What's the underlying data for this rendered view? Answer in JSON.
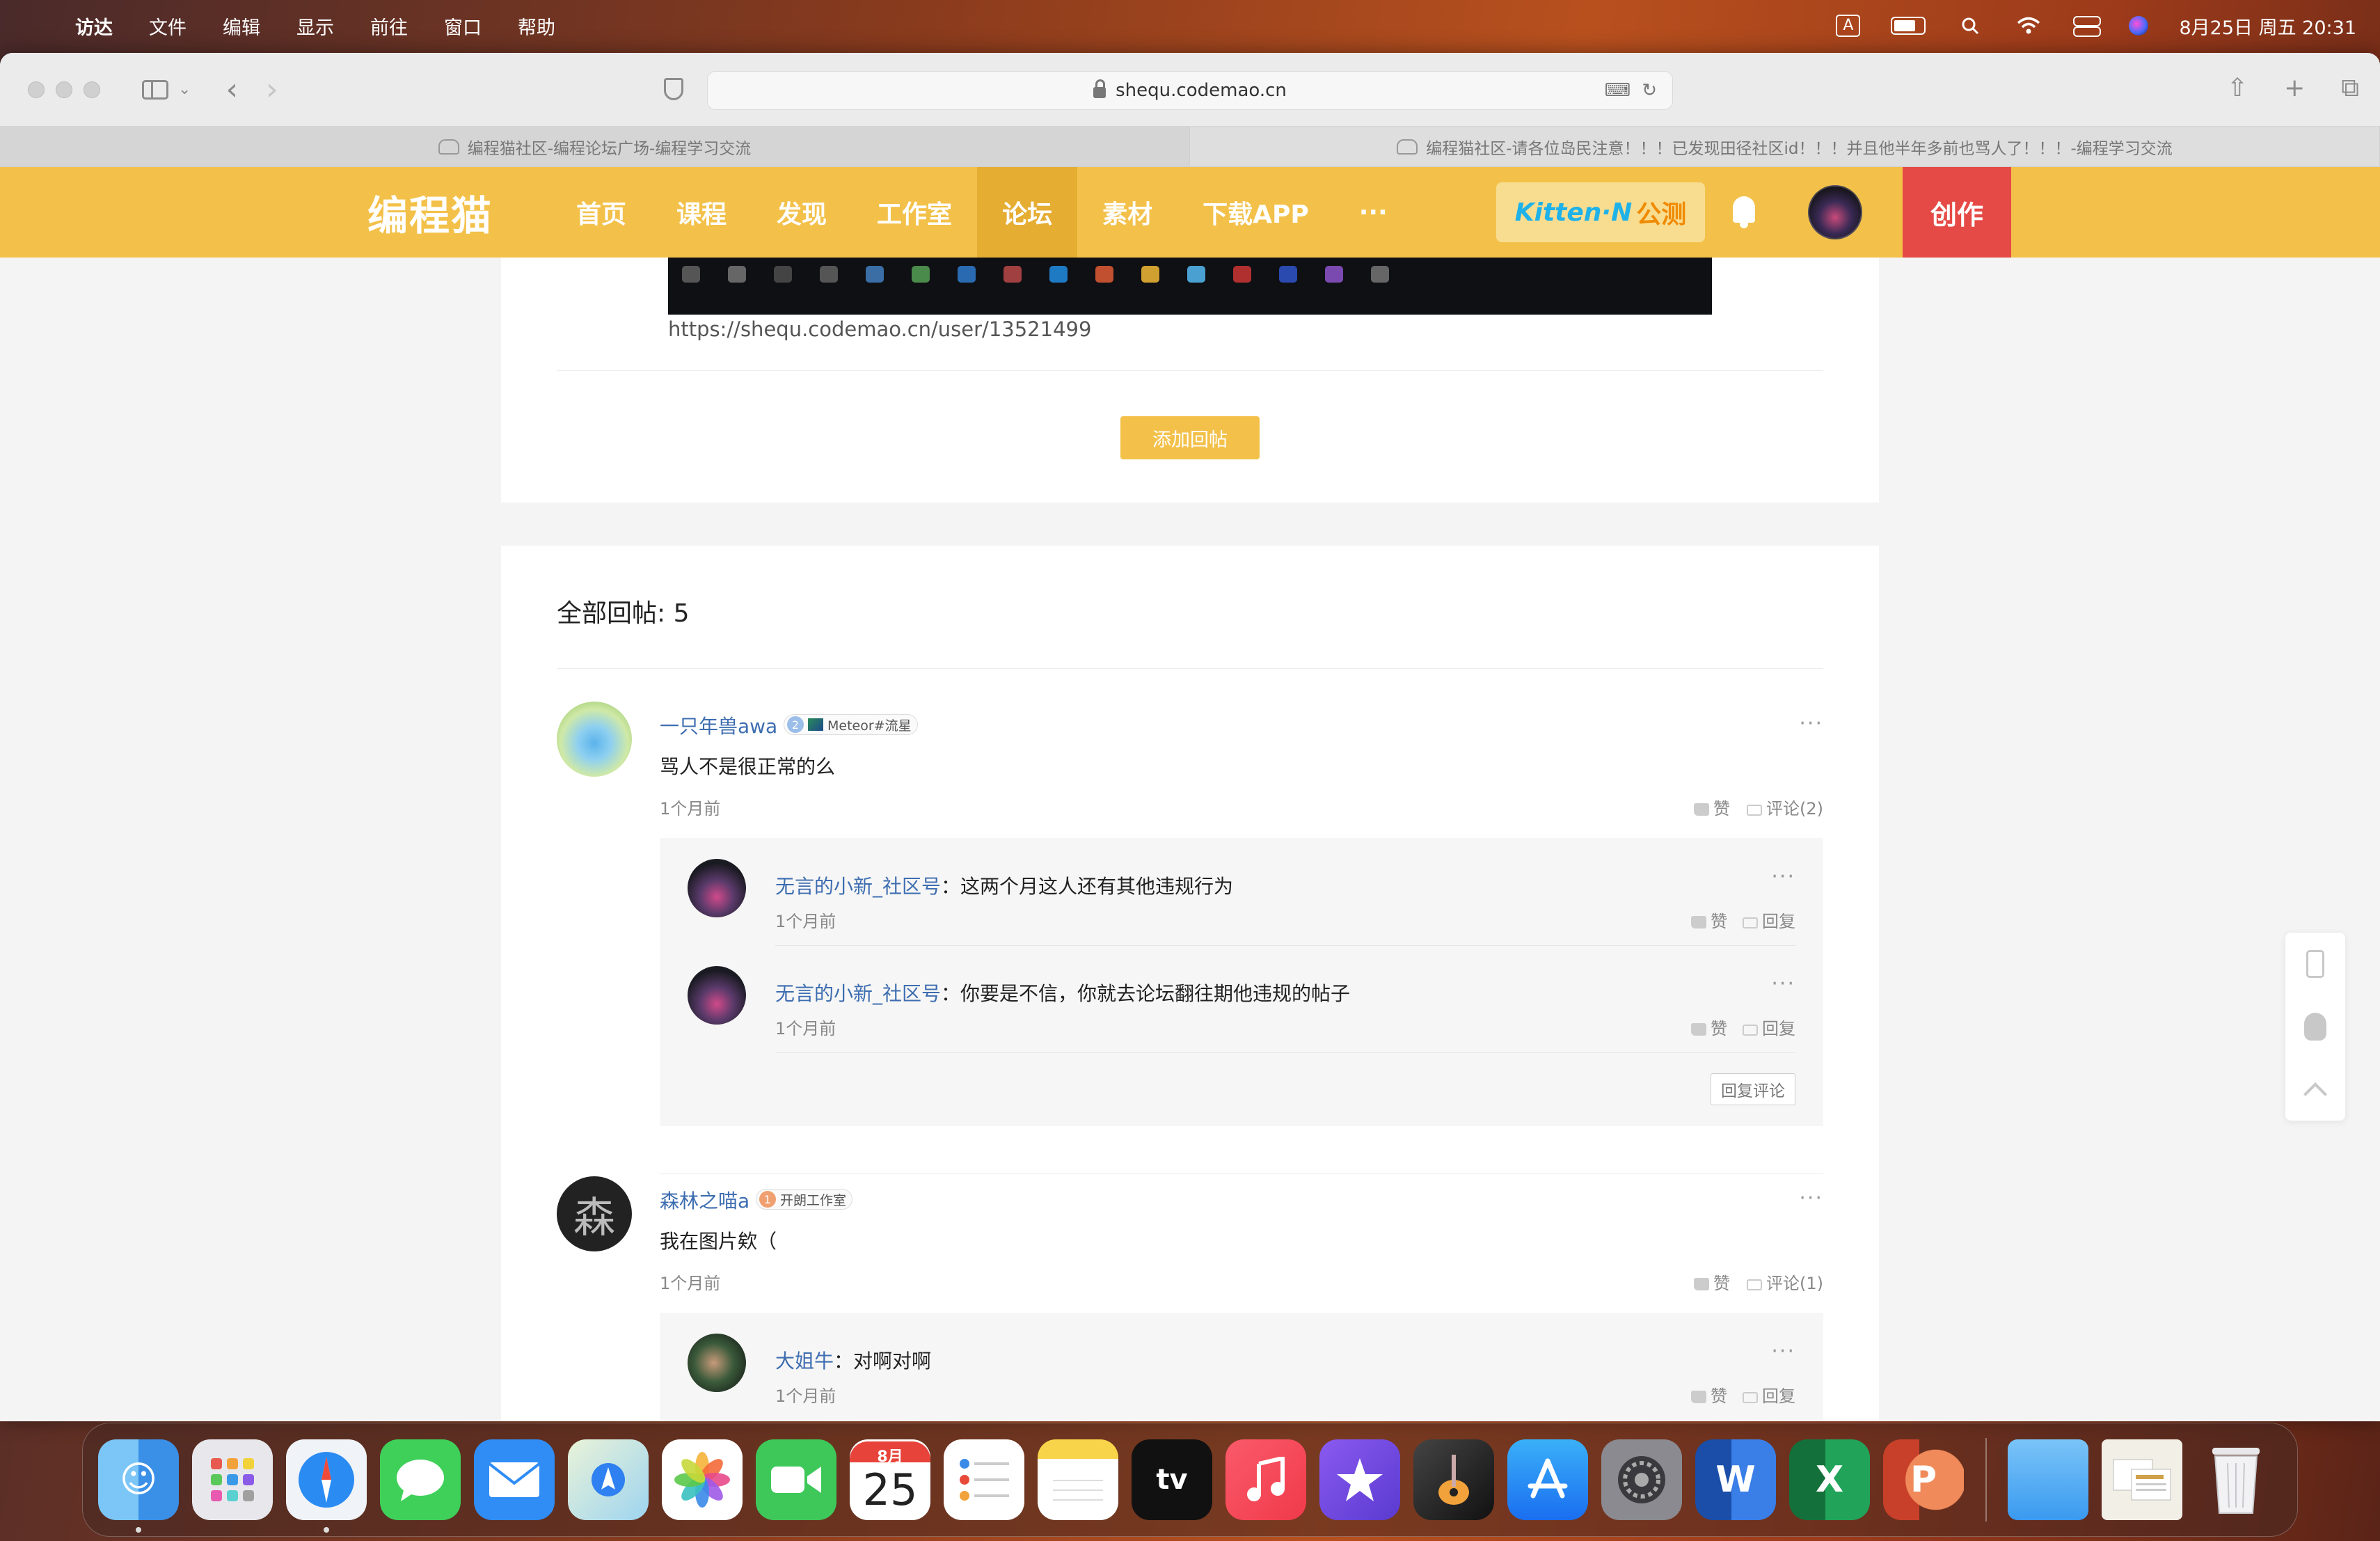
{
  "menubar": {
    "apple": "",
    "app_name": "访达",
    "items": [
      "文件",
      "编辑",
      "显示",
      "前往",
      "窗口",
      "帮助"
    ],
    "input_method": "A",
    "datetime": "8月25日 周五  20:31"
  },
  "browser": {
    "url": "shequ.codemao.cn",
    "tabs": [
      {
        "title": "编程猫社区-编程论坛广场-编程学习交流",
        "active": true
      },
      {
        "title": "编程猫社区-请各位岛民注意！！！已发现田径社区id！！！并且他半年多前也骂人了！！！-编程学习交流",
        "active": false
      }
    ]
  },
  "site": {
    "logo": "编程猫",
    "nav": [
      "首页",
      "课程",
      "发现",
      "工作室",
      "论坛",
      "素材",
      "下载APP",
      "···"
    ],
    "active_nav": "论坛",
    "kitten_label": "Kitten·N",
    "kitten_badge": "公测",
    "create_label": "创作",
    "accent_color": "#f3c14a",
    "create_color": "#e54a46"
  },
  "post": {
    "link": "https://shequ.codemao.cn/user/13521499",
    "add_reply": "添加回帖"
  },
  "replies": {
    "header": "全部回帖: 5",
    "items": [
      {
        "name": "一只年兽awa",
        "badge_level": "2",
        "badge_text": "Meteor#流星",
        "text": "骂人不是很正常的么",
        "time": "1个月前",
        "like": "赞",
        "comment": "评论(2)",
        "comments": [
          {
            "name": "无言的小新_社区号",
            "sep": "：",
            "text": "这两个月这人还有其他违规行为",
            "time": "1个月前",
            "like": "赞",
            "reply": "回复"
          },
          {
            "name": "无言的小新_社区号",
            "sep": "：",
            "text": "你要是不信，你就去论坛翻往期他违规的帖子",
            "time": "1个月前",
            "like": "赞",
            "reply": "回复"
          }
        ],
        "reply_comment": "回复评论"
      },
      {
        "name": "森林之喵a",
        "avatar_char": "森",
        "badge_level": "1",
        "badge_text": "开朗工作室",
        "text": "我在图片欸（",
        "time": "1个月前",
        "like": "赞",
        "comment": "评论(1)",
        "comments": [
          {
            "name": "大姐牛",
            "sep": "：",
            "text": "对啊对啊",
            "time": "1个月前",
            "like": "赞",
            "reply": "回复"
          }
        ]
      }
    ]
  },
  "dock": {
    "apps": [
      "finder-icon",
      "launchpad-icon",
      "safari-icon",
      "messages-icon",
      "mail-icon",
      "maps-icon",
      "photos-icon",
      "facetime-icon",
      "calendar-icon",
      "reminders-icon",
      "notes-icon",
      "appletv-icon",
      "music-icon",
      "imovie-icon",
      "garageband-icon",
      "appstore-icon",
      "system-settings-icon",
      "word-icon",
      "excel-icon",
      "powerpoint-icon"
    ],
    "calendar_month": "8月",
    "calendar_day": "25",
    "tv_label": "tv",
    "word_letter": "W",
    "excel_letter": "X",
    "ppt_letter": "P"
  }
}
